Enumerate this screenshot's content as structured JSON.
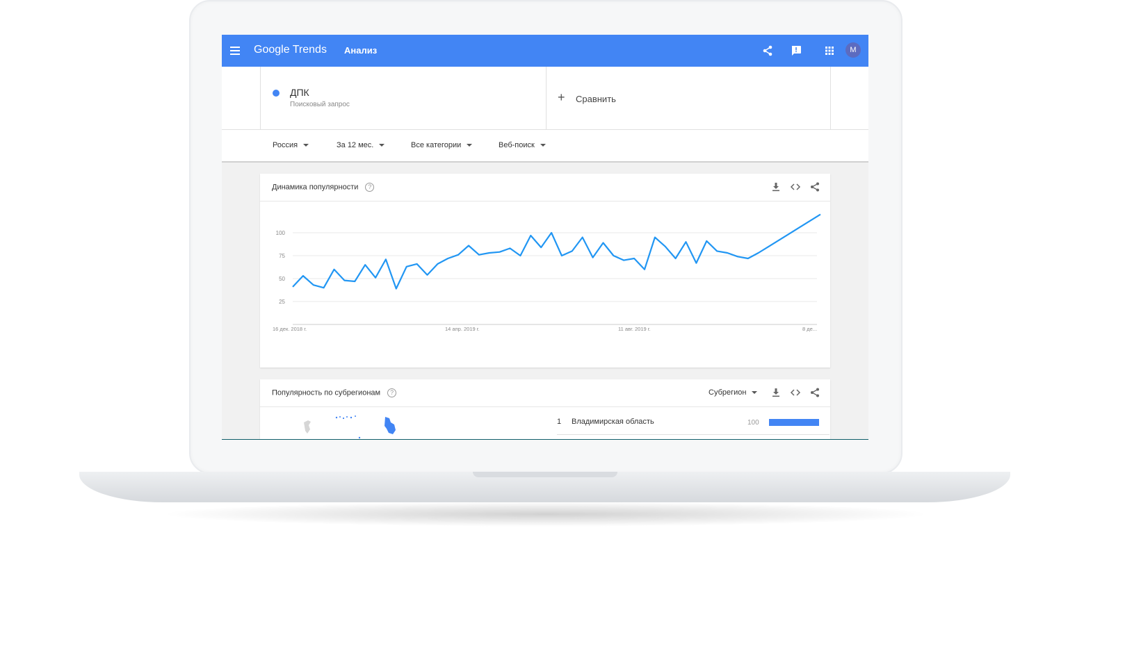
{
  "header": {
    "menu_icon": "menu-icon",
    "logo": "Google Trends",
    "title": "Анализ",
    "icons": [
      "share-icon",
      "feedback-icon",
      "apps-icon"
    ],
    "avatar_letter": "M",
    "brand_color": "#4285f4"
  },
  "search_term": {
    "name": "ДПК",
    "subtitle": "Поисковый запрос",
    "color": "#4285f4"
  },
  "compare": {
    "label": "Сравнить"
  },
  "filters": [
    {
      "label": "Россия"
    },
    {
      "label": "За 12 мес."
    },
    {
      "label": "Все категории"
    },
    {
      "label": "Веб-поиск"
    }
  ],
  "interest_card": {
    "title": "Динамика популярности",
    "icons": [
      "download-icon",
      "embed-icon",
      "share-icon"
    ]
  },
  "chart_data": {
    "type": "line",
    "title": "",
    "xlabel": "",
    "ylabel": "",
    "x_tick_labels": [
      "16 дек. 2018 г.",
      "14 апр. 2019 г.",
      "11 авг. 2019 г.",
      "8 де..."
    ],
    "y_tick_labels": [
      "25",
      "50",
      "75",
      "100"
    ],
    "ylim": [
      0,
      100
    ],
    "grid": true,
    "series": [
      {
        "color": "#2196f3",
        "values": [
          41,
          53,
          43,
          40,
          60,
          48,
          47,
          65,
          51,
          71,
          39,
          63,
          66,
          54,
          66,
          72,
          76,
          86,
          76,
          78,
          79,
          83,
          75,
          97,
          84,
          100,
          75,
          80,
          95,
          73,
          89,
          75,
          70,
          72,
          60,
          95,
          85,
          72,
          90,
          67,
          91,
          80,
          78,
          74,
          72,
          78,
          85,
          92,
          99,
          106,
          113,
          120
        ]
      }
    ]
  },
  "region_card": {
    "title": "Популярность по субрегионам",
    "select_label": "Субрегион",
    "icons": [
      "download-icon",
      "embed-icon",
      "share-icon"
    ],
    "rows": [
      {
        "rank": "1",
        "name": "Владимирская область",
        "value": "100",
        "fill": 1.0
      }
    ]
  }
}
